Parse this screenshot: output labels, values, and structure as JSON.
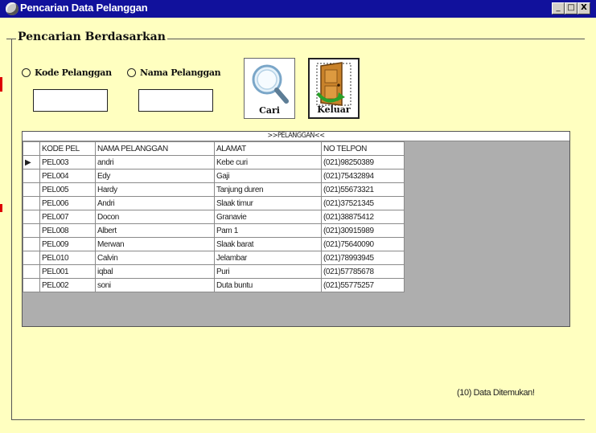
{
  "window": {
    "title": "Pencarian Data Pelanggan",
    "controls": {
      "minimize": "_",
      "maximize": "□",
      "close": "X"
    }
  },
  "search_group": {
    "caption": "Pencarian Berdasarkan",
    "radio_kode": "Kode Pelanggan",
    "radio_nama": "Nama Pelanggan",
    "input_kode_value": "",
    "input_nama_value": ""
  },
  "buttons": {
    "cari": {
      "label": "Cari",
      "icon": "magnifier-icon"
    },
    "keluar": {
      "label": "Keluar",
      "icon": "exit-door-icon"
    }
  },
  "grid": {
    "caption": ">>PELANGGAN<<",
    "columns": [
      "KODE PEL",
      "NAMA PELANGGAN",
      "ALAMAT",
      "NO TELPON"
    ],
    "rows": [
      [
        "PEL003",
        "andri",
        "Kebe curi",
        "(021)98250389"
      ],
      [
        "PEL004",
        "Edy",
        "Gaji",
        "(021)75432894"
      ],
      [
        "PEL005",
        "Hardy",
        "Tanjung duren",
        "(021)55673321"
      ],
      [
        "PEL006",
        "Andri",
        "Slaak timur",
        "(021)37521345"
      ],
      [
        "PEL007",
        "Docon",
        "Granavie",
        "(021)38875412"
      ],
      [
        "PEL008",
        "Albert",
        "Pam 1",
        "(021)30915989"
      ],
      [
        "PEL009",
        "Merwan",
        "Slaak barat",
        "(021)75640090"
      ],
      [
        "PEL010",
        "Calvin",
        "Jelambar",
        "(021)78993945"
      ],
      [
        "PEL001",
        "iqbal",
        "Puri",
        "(021)57785678"
      ],
      [
        "PEL002",
        "soni",
        "Duta buntu",
        "(021)55775257"
      ]
    ],
    "selected_row": 0,
    "selected_marker": "▶"
  },
  "status": {
    "text": "(10) Data Ditemukan!"
  },
  "colors": {
    "titlebar": "#11119c",
    "background": "#ffffc0",
    "grid_background": "#aeaeae"
  }
}
